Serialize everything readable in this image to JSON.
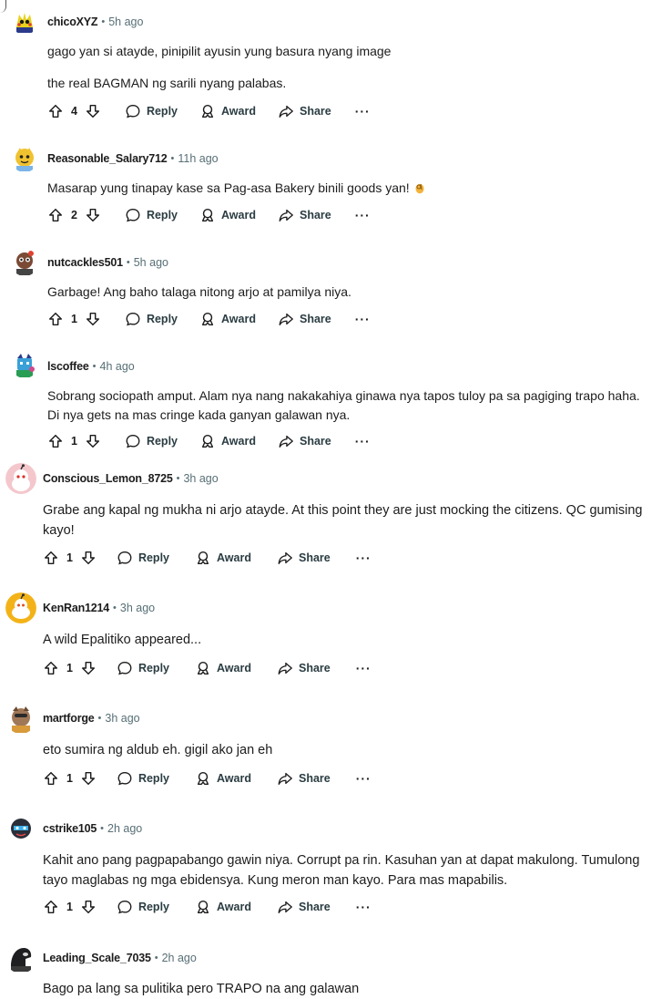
{
  "actions": {
    "reply": "Reply",
    "award": "Award",
    "share": "Share",
    "more": "···"
  },
  "comments": [
    {
      "user": "chicoXYZ",
      "time": "5h ago",
      "lines": [
        "gago yan si atayde, pinipilit ayusin yung basura nyang image",
        "the real BAGMAN ng sarili nyang palabas."
      ],
      "votes": "4"
    },
    {
      "user": "Reasonable_Salary712",
      "time": "11h ago",
      "lines": [
        "Masarap yung tinapay kase sa Pag-asa Bakery binili goods yan!"
      ],
      "votes": "2",
      "emoji": "ok-hand-emoji"
    },
    {
      "user": "nutcackles501",
      "time": "5h ago",
      "lines": [
        "Garbage! Ang baho talaga nitong arjo at pamilya niya."
      ],
      "votes": "1"
    },
    {
      "user": "lscoffee",
      "time": "4h ago",
      "lines": [
        "Sobrang sociopath amput. Alam nya nang nakakahiya ginawa nya tapos tuloy pa sa pagiging trapo haha.",
        "Di nya gets na mas cringe kada ganyan galawan nya."
      ],
      "votes": "1"
    },
    {
      "user": "Conscious_Lemon_8725",
      "time": "3h ago",
      "lines": [
        "Grabe ang kapal ng mukha ni arjo atayde. At this point they are just mocking the citizens. QC gumising",
        "kayo!"
      ],
      "votes": "1"
    },
    {
      "user": "KenRan1214",
      "time": "3h ago",
      "lines": [
        "A wild Epalitiko appeared..."
      ],
      "votes": "1"
    },
    {
      "user": "martforge",
      "time": "3h ago",
      "lines": [
        "eto sumira ng aldub eh. gigil ako jan eh"
      ],
      "votes": "1"
    },
    {
      "user": "cstrike105",
      "time": "2h ago",
      "lines": [
        "Kahit ano pang pagpapabango gawin niya. Corrupt pa rin. Kasuhan yan at dapat makulong. Tumulong",
        "tayo maglabas ng mga ebidensya. Kung meron man kayo. Para mas mapabilis."
      ],
      "votes": "1"
    },
    {
      "user": "Leading_Scale_7035",
      "time": "2h ago",
      "lines": [
        "Bago pa lang sa pulitika pero TRAPO na ang galawan"
      ]
    }
  ]
}
